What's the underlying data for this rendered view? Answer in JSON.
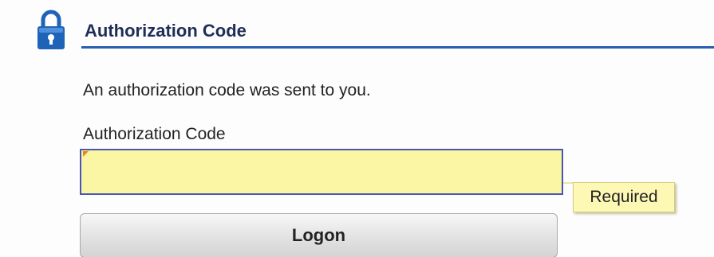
{
  "header": {
    "title": "Authorization Code",
    "icon": "lock-icon",
    "accent_color": "#2a5db0"
  },
  "message": {
    "text": "An authorization code was sent to you."
  },
  "auth_code_field": {
    "label": "Authorization Code",
    "value": "",
    "background_color": "#fbf6a3",
    "required_tooltip": "Required"
  },
  "logon_button": {
    "label": "Logon"
  }
}
